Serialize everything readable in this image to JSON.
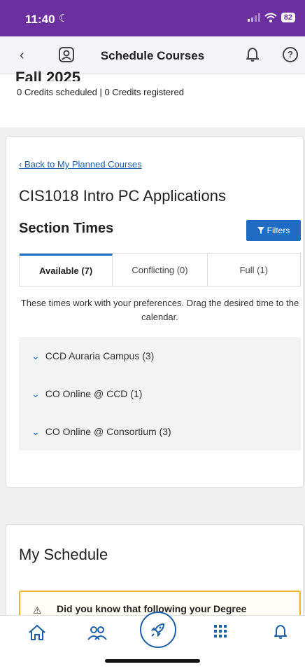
{
  "status_bar": {
    "time": "11:40",
    "battery": "82"
  },
  "nav": {
    "title": "Schedule Courses",
    "help_glyph": "?"
  },
  "term": {
    "title": "Fall 2025",
    "credits": "0 Credits scheduled | 0 Credits registered"
  },
  "course": {
    "back_link": "Back to My Planned Courses",
    "title": "CIS1018 Intro PC Applications",
    "section_heading": "Section Times",
    "filters_label": "Filters"
  },
  "tabs": [
    {
      "label": "Available (7)",
      "active": true
    },
    {
      "label": "Conflicting (0)",
      "active": false
    },
    {
      "label": "Full (1)",
      "active": false
    }
  ],
  "info_text": "These times work with your preferences. Drag the desired time to the calendar.",
  "campuses": [
    {
      "label": "CCD Auraria Campus (3)"
    },
    {
      "label": "CO Online @ CCD (1)"
    },
    {
      "label": "CO Online @ Consortium (3)"
    }
  ],
  "schedule": {
    "title": "My Schedule",
    "alert_text": "Did you know that following your Degree"
  },
  "colors": {
    "status_bar": "#6b2fa0",
    "accent": "#1f6cc4",
    "link": "#1a5fa8",
    "alert_border": "#f0b429"
  }
}
